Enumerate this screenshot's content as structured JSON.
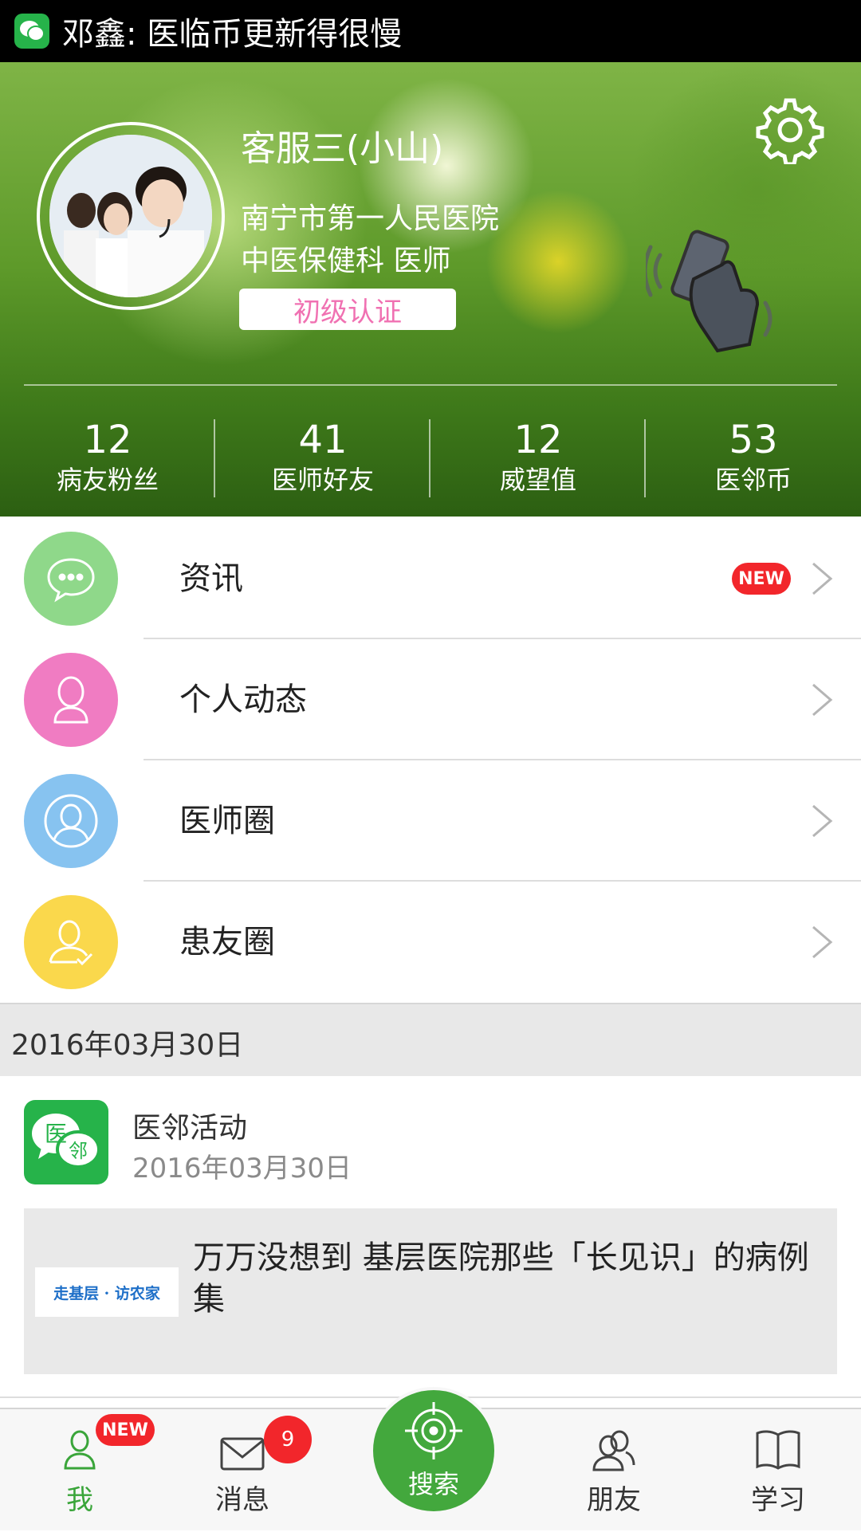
{
  "notification": {
    "app_icon": "yilin-chat-icon",
    "text": "邓鑫: 医临币更新得很慢"
  },
  "profile": {
    "name": "客服三(小山)",
    "hospital": "南宁市第一人民医院",
    "department": "中医保健科 医师",
    "certification": "初级认证",
    "icons": [
      "settings-gear-icon",
      "shake-phone-icon"
    ]
  },
  "stats": [
    {
      "value": "12",
      "label": "病友粉丝"
    },
    {
      "value": "41",
      "label": "医师好友"
    },
    {
      "value": "12",
      "label": "威望值"
    },
    {
      "value": "53",
      "label": "医邻币"
    }
  ],
  "menu": [
    {
      "label": "资讯",
      "icon": "chat-bubble-icon",
      "color": "#8fd88a",
      "badge": "NEW"
    },
    {
      "label": "个人动态",
      "icon": "person-icon",
      "color": "#f07cc2"
    },
    {
      "label": "医师圈",
      "icon": "doctor-profile-icon",
      "color": "#87c3f0"
    },
    {
      "label": "患友圈",
      "icon": "patient-profile-icon",
      "color": "#fad84c"
    }
  ],
  "feed": {
    "date_header": "2016年03月30日",
    "source_name": "医邻活动",
    "source_date": "2016年03月30日",
    "logo_text": [
      "医",
      "邻"
    ],
    "article_thumb_text": "走基层 · 访农家",
    "article_title": "万万没想到 基层医院那些「长见识」的病例集"
  },
  "tabbar": {
    "me": {
      "label": "我",
      "badge": "NEW"
    },
    "messages": {
      "label": "消息",
      "badge": "9"
    },
    "search": {
      "label": "搜索"
    },
    "friends": {
      "label": "朋友"
    },
    "study": {
      "label": "学习"
    }
  },
  "colors": {
    "brand_green": "#26b34a",
    "active_tab": "#3aa53a",
    "badge_red": "#f2262b",
    "cert_pink": "#f071b2"
  }
}
